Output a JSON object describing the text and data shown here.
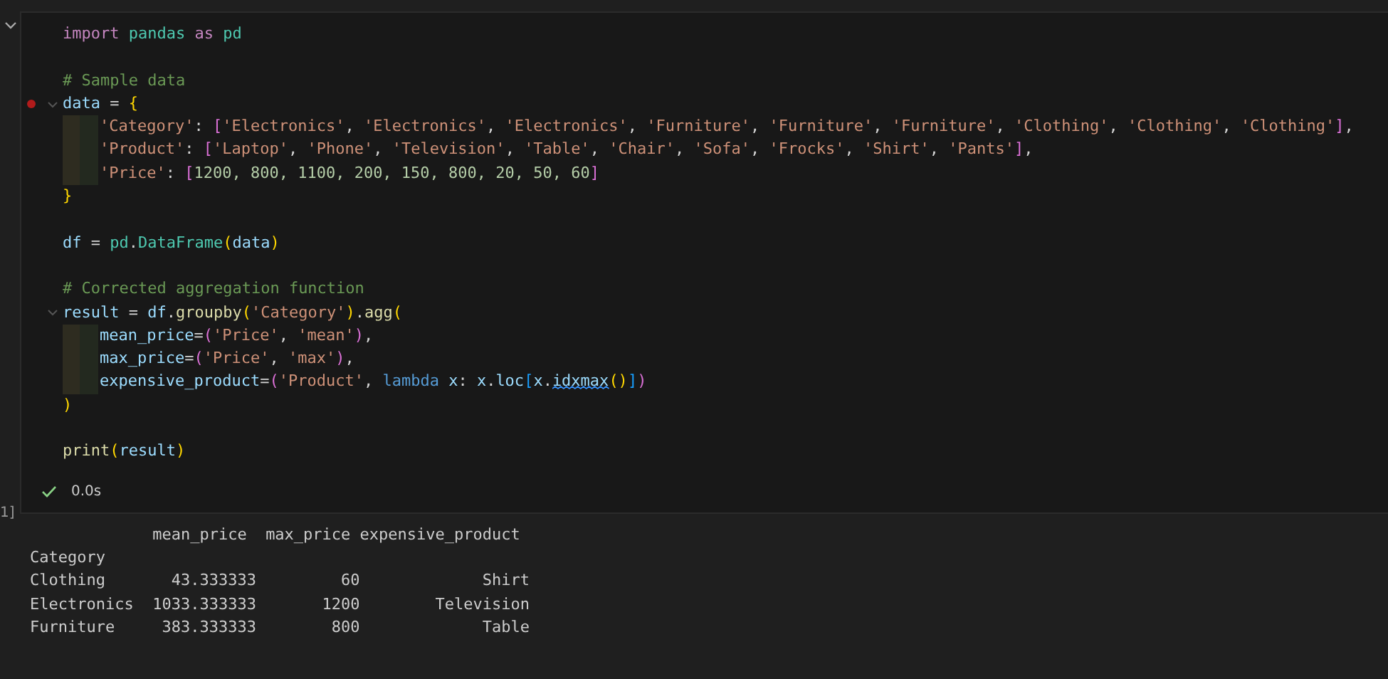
{
  "cell": {
    "collapsed": false,
    "execution_count": "1]",
    "status": {
      "success": true,
      "duration": "0.0s"
    },
    "lines": [
      {
        "tokens": [
          {
            "text": "import ",
            "kind": "keyword"
          },
          {
            "text": "pandas ",
            "kind": "module"
          },
          {
            "text": "as ",
            "kind": "keyword"
          },
          {
            "text": "pd",
            "kind": "module"
          }
        ]
      },
      {
        "blank_before": true,
        "tokens": [
          {
            "text": "# Sample data",
            "kind": "comment"
          }
        ]
      },
      {
        "breakpoint": true,
        "foldable": true,
        "tokens": [
          {
            "text": "data",
            "kind": "variable"
          },
          {
            "text": " = ",
            "kind": "operator"
          },
          {
            "text": "{",
            "kind": "brace"
          }
        ]
      },
      {
        "indented": true,
        "tokens": [
          {
            "text": "'Category'",
            "kind": "string"
          },
          {
            "text": ": ",
            "kind": "operator"
          },
          {
            "text": "[",
            "kind": "bracket"
          },
          {
            "text": "'Electronics'",
            "kind": "string"
          },
          {
            "text": ", ",
            "kind": "operator"
          },
          {
            "text": "'Electronics'",
            "kind": "string"
          },
          {
            "text": ", ",
            "kind": "operator"
          },
          {
            "text": "'Electronics'",
            "kind": "string"
          },
          {
            "text": ", ",
            "kind": "operator"
          },
          {
            "text": "'Furniture'",
            "kind": "string"
          },
          {
            "text": ", ",
            "kind": "operator"
          },
          {
            "text": "'Furniture'",
            "kind": "string"
          },
          {
            "text": ", ",
            "kind": "operator"
          },
          {
            "text": "'Furniture'",
            "kind": "string"
          },
          {
            "text": ", ",
            "kind": "operator"
          },
          {
            "text": "'Clothing'",
            "kind": "string"
          },
          {
            "text": ", ",
            "kind": "operator"
          },
          {
            "text": "'Clothing'",
            "kind": "string"
          },
          {
            "text": ", ",
            "kind": "operator"
          },
          {
            "text": "'Clothing'",
            "kind": "string"
          },
          {
            "text": "]",
            "kind": "bracket"
          },
          {
            "text": ",",
            "kind": "operator"
          }
        ]
      },
      {
        "indented": true,
        "tokens": [
          {
            "text": "'Product'",
            "kind": "string"
          },
          {
            "text": ": ",
            "kind": "operator"
          },
          {
            "text": "[",
            "kind": "bracket"
          },
          {
            "text": "'Laptop'",
            "kind": "string"
          },
          {
            "text": ", ",
            "kind": "operator"
          },
          {
            "text": "'Phone'",
            "kind": "string"
          },
          {
            "text": ", ",
            "kind": "operator"
          },
          {
            "text": "'Television'",
            "kind": "string"
          },
          {
            "text": ", ",
            "kind": "operator"
          },
          {
            "text": "'Table'",
            "kind": "string"
          },
          {
            "text": ", ",
            "kind": "operator"
          },
          {
            "text": "'Chair'",
            "kind": "string"
          },
          {
            "text": ", ",
            "kind": "operator"
          },
          {
            "text": "'Sofa'",
            "kind": "string"
          },
          {
            "text": ", ",
            "kind": "operator"
          },
          {
            "text": "'Frocks'",
            "kind": "string"
          },
          {
            "text": ", ",
            "kind": "operator"
          },
          {
            "text": "'Shirt'",
            "kind": "string"
          },
          {
            "text": ", ",
            "kind": "operator"
          },
          {
            "text": "'Pants'",
            "kind": "string"
          },
          {
            "text": "]",
            "kind": "bracket"
          },
          {
            "text": ",",
            "kind": "operator"
          }
        ]
      },
      {
        "indented": true,
        "tokens": [
          {
            "text": "'Price'",
            "kind": "string"
          },
          {
            "text": ": ",
            "kind": "operator"
          },
          {
            "text": "[",
            "kind": "bracket"
          },
          {
            "text": "1200, 800, 1100, 200, 150, 800, 20, 50, 60",
            "kind": "number"
          },
          {
            "text": "]",
            "kind": "bracket"
          }
        ]
      },
      {
        "tokens": [
          {
            "text": "}",
            "kind": "brace"
          }
        ]
      },
      {
        "blank_before": true,
        "tokens": [
          {
            "text": "df",
            "kind": "variable"
          },
          {
            "text": " = ",
            "kind": "operator"
          },
          {
            "text": "pd",
            "kind": "module"
          },
          {
            "text": ".",
            "kind": "operator"
          },
          {
            "text": "DataFrame",
            "kind": "module"
          },
          {
            "text": "(",
            "kind": "brace"
          },
          {
            "text": "data",
            "kind": "variable"
          },
          {
            "text": ")",
            "kind": "brace"
          }
        ]
      },
      {
        "blank_before": true,
        "tokens": [
          {
            "text": "# Corrected aggregation function",
            "kind": "comment"
          }
        ]
      },
      {
        "foldable": true,
        "tokens": [
          {
            "text": "result",
            "kind": "variable"
          },
          {
            "text": " = ",
            "kind": "operator"
          },
          {
            "text": "df",
            "kind": "variable"
          },
          {
            "text": ".",
            "kind": "operator"
          },
          {
            "text": "groupby",
            "kind": "function"
          },
          {
            "text": "(",
            "kind": "brace"
          },
          {
            "text": "'Category'",
            "kind": "string"
          },
          {
            "text": ")",
            "kind": "brace"
          },
          {
            "text": ".",
            "kind": "operator"
          },
          {
            "text": "agg",
            "kind": "function"
          },
          {
            "text": "(",
            "kind": "brace"
          }
        ]
      },
      {
        "indented": true,
        "tokens": [
          {
            "text": "mean_price",
            "kind": "variable"
          },
          {
            "text": "=",
            "kind": "operator"
          },
          {
            "text": "(",
            "kind": "bracket"
          },
          {
            "text": "'Price'",
            "kind": "string"
          },
          {
            "text": ", ",
            "kind": "operator"
          },
          {
            "text": "'mean'",
            "kind": "string"
          },
          {
            "text": ")",
            "kind": "bracket"
          },
          {
            "text": ",",
            "kind": "operator"
          }
        ]
      },
      {
        "indented": true,
        "tokens": [
          {
            "text": "max_price",
            "kind": "variable"
          },
          {
            "text": "=",
            "kind": "operator"
          },
          {
            "text": "(",
            "kind": "bracket"
          },
          {
            "text": "'Price'",
            "kind": "string"
          },
          {
            "text": ", ",
            "kind": "operator"
          },
          {
            "text": "'max'",
            "kind": "string"
          },
          {
            "text": ")",
            "kind": "bracket"
          },
          {
            "text": ",",
            "kind": "operator"
          }
        ]
      },
      {
        "indented": true,
        "tokens": [
          {
            "text": "expensive_product",
            "kind": "variable"
          },
          {
            "text": "=",
            "kind": "operator"
          },
          {
            "text": "(",
            "kind": "bracket"
          },
          {
            "text": "'Product'",
            "kind": "string"
          },
          {
            "text": ", ",
            "kind": "operator"
          },
          {
            "text": "lambda ",
            "kind": "lambda"
          },
          {
            "text": "x",
            "kind": "variable"
          },
          {
            "text": ": ",
            "kind": "operator"
          },
          {
            "text": "x",
            "kind": "variable"
          },
          {
            "text": ".",
            "kind": "operator"
          },
          {
            "text": "loc",
            "kind": "variable"
          },
          {
            "text": "[",
            "kind": "index"
          },
          {
            "text": "x",
            "kind": "variable"
          },
          {
            "text": ".",
            "kind": "operator"
          },
          {
            "text": "idxmax",
            "kind": "variable",
            "squiggle": true
          },
          {
            "text": "()",
            "kind": "brace"
          },
          {
            "text": "]",
            "kind": "index"
          },
          {
            "text": ")",
            "kind": "bracket"
          }
        ]
      },
      {
        "tokens": [
          {
            "text": ")",
            "kind": "brace"
          }
        ]
      },
      {
        "blank_before": true,
        "tokens": [
          {
            "text": "print",
            "kind": "function"
          },
          {
            "text": "(",
            "kind": "brace"
          },
          {
            "text": "result",
            "kind": "variable"
          },
          {
            "text": ")",
            "kind": "brace"
          }
        ]
      }
    ]
  },
  "output": {
    "lines": [
      "             mean_price  max_price expensive_product",
      "Category",
      "Clothing       43.333333         60             Shirt",
      "Electronics  1033.333333       1200        Television",
      "Furniture     383.333333        800             Table"
    ]
  }
}
